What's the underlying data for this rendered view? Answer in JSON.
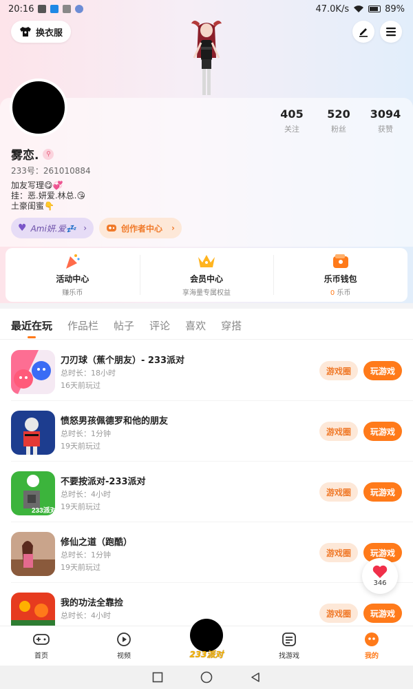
{
  "statusbar": {
    "time": "20:16",
    "speed": "47.0K/s",
    "battery": "89%"
  },
  "header": {
    "dressup_label": "换衣服"
  },
  "profile": {
    "stats": [
      {
        "num": "405",
        "label": "关注"
      },
      {
        "num": "520",
        "label": "粉丝"
      },
      {
        "num": "3094",
        "label": "获赞"
      }
    ],
    "nickname": "雾恋.",
    "uid": "233号：261010884",
    "bio": [
      "加友写理😋💞",
      "挂：恶.妍爱.林总.😘",
      "土豪闺蜜👇"
    ],
    "tag_love": "Ami妍.爱💤",
    "tag_creator": "创作者中心"
  },
  "quick": [
    {
      "title": "活动中心",
      "sub": "赚乐币"
    },
    {
      "title": "会员中心",
      "sub": "享海量专属权益"
    },
    {
      "title": "乐币钱包",
      "sub_num": "0",
      "sub": "乐币"
    }
  ],
  "tabs": [
    "最近在玩",
    "作品栏",
    "帖子",
    "评论",
    "喜欢",
    "穿搭"
  ],
  "games": [
    {
      "name": "刀刃球（蕉个朋友）- 233派对",
      "time": "总时长：18小时",
      "last": "16天前玩过"
    },
    {
      "name": "愤怒男孩佩德罗和他的朋友",
      "time": "总时长：1分钟",
      "last": "19天前玩过"
    },
    {
      "name": "不要按派对-233派对",
      "time": "总时长：4小时",
      "last": "19天前玩过"
    },
    {
      "name": "修仙之道（跑酷）",
      "time": "总时长：1分钟",
      "last": "19天前玩过"
    },
    {
      "name": "我的功法全靠捡",
      "time": "总时长：4小时",
      "last": ""
    }
  ],
  "buttons": {
    "circle": "游戏圈",
    "play": "玩游戏"
  },
  "icon_badge": "233派对",
  "like": {
    "count": "346"
  },
  "nav": [
    {
      "label": "首页"
    },
    {
      "label": "视频"
    },
    {
      "label": "233派对"
    },
    {
      "label": "找游戏"
    },
    {
      "label": "我的"
    }
  ],
  "colors": {
    "accent": "#ff7a1a",
    "accent_light": "#fde8d8"
  }
}
